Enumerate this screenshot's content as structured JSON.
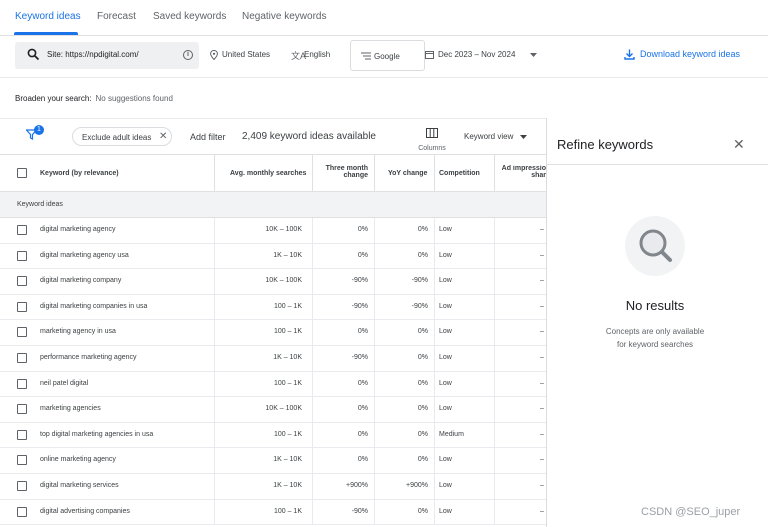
{
  "tabs": [
    "Keyword ideas",
    "Forecast",
    "Saved keywords",
    "Negative keywords"
  ],
  "filters": {
    "site_value": "Site: https://npdigital.com/",
    "location": "United States",
    "language": "English",
    "network": "Google",
    "date_range": "Dec 2023 – Nov 2024",
    "download_label": "Download keyword ideas"
  },
  "broaden": {
    "label": "Broaden your search:",
    "value": "No suggestions found"
  },
  "toolbar": {
    "filter_badge": "1",
    "adult_chip": "Exclude adult ideas",
    "add_filter": "Add filter",
    "count_text": "2,409 keyword ideas available",
    "columns_label": "Columns",
    "view_label": "Keyword view"
  },
  "table": {
    "headers": {
      "keyword": "Keyword (by relevance)",
      "avg": "Avg. monthly searches",
      "three_month_1": "Three month",
      "three_month_2": "change",
      "yoy": "YoY change",
      "competition": "Competition",
      "ad_1": "Ad impressio",
      "ad_2": "shar"
    },
    "section_label": "Keyword ideas",
    "rows": [
      {
        "keyword": "digital marketing agency",
        "avg": "10K – 100K",
        "three_month": "0%",
        "yoy": "0%",
        "competition": "Low",
        "ad": "–"
      },
      {
        "keyword": "digital marketing agency usa",
        "avg": "1K – 10K",
        "three_month": "0%",
        "yoy": "0%",
        "competition": "Low",
        "ad": "–"
      },
      {
        "keyword": "digital marketing company",
        "avg": "10K – 100K",
        "three_month": "-90%",
        "yoy": "-90%",
        "competition": "Low",
        "ad": "–"
      },
      {
        "keyword": "digital marketing companies in usa",
        "avg": "100 – 1K",
        "three_month": "-90%",
        "yoy": "-90%",
        "competition": "Low",
        "ad": "–"
      },
      {
        "keyword": "marketing agency in usa",
        "avg": "100 – 1K",
        "three_month": "0%",
        "yoy": "0%",
        "competition": "Low",
        "ad": "–"
      },
      {
        "keyword": "performance marketing agency",
        "avg": "1K – 10K",
        "three_month": "-90%",
        "yoy": "0%",
        "competition": "Low",
        "ad": "–"
      },
      {
        "keyword": "neil patel digital",
        "avg": "100 – 1K",
        "three_month": "0%",
        "yoy": "0%",
        "competition": "Low",
        "ad": "–"
      },
      {
        "keyword": "marketing agencies",
        "avg": "10K – 100K",
        "three_month": "0%",
        "yoy": "0%",
        "competition": "Low",
        "ad": "–"
      },
      {
        "keyword": "top digital marketing agencies in usa",
        "avg": "100 – 1K",
        "three_month": "0%",
        "yoy": "0%",
        "competition": "Medium",
        "ad": "–"
      },
      {
        "keyword": "online marketing agency",
        "avg": "1K – 10K",
        "three_month": "0%",
        "yoy": "0%",
        "competition": "Low",
        "ad": "–"
      },
      {
        "keyword": "digital marketing services",
        "avg": "1K – 10K",
        "three_month": "+900%",
        "yoy": "+900%",
        "competition": "Low",
        "ad": "–"
      },
      {
        "keyword": "digital advertising companies",
        "avg": "100 – 1K",
        "three_month": "-90%",
        "yoy": "0%",
        "competition": "Low",
        "ad": "–"
      }
    ]
  },
  "panel": {
    "title": "Refine keywords",
    "no_results": "No results",
    "concepts_line1": "Concepts are only available",
    "concepts_line2": "for keyword searches"
  },
  "watermark": "CSDN @SEO_juper",
  "colors": {
    "accent": "#1a73e8",
    "text": "#3c4043",
    "muted": "#5f6368",
    "section_bg": "#f1f3f4"
  }
}
